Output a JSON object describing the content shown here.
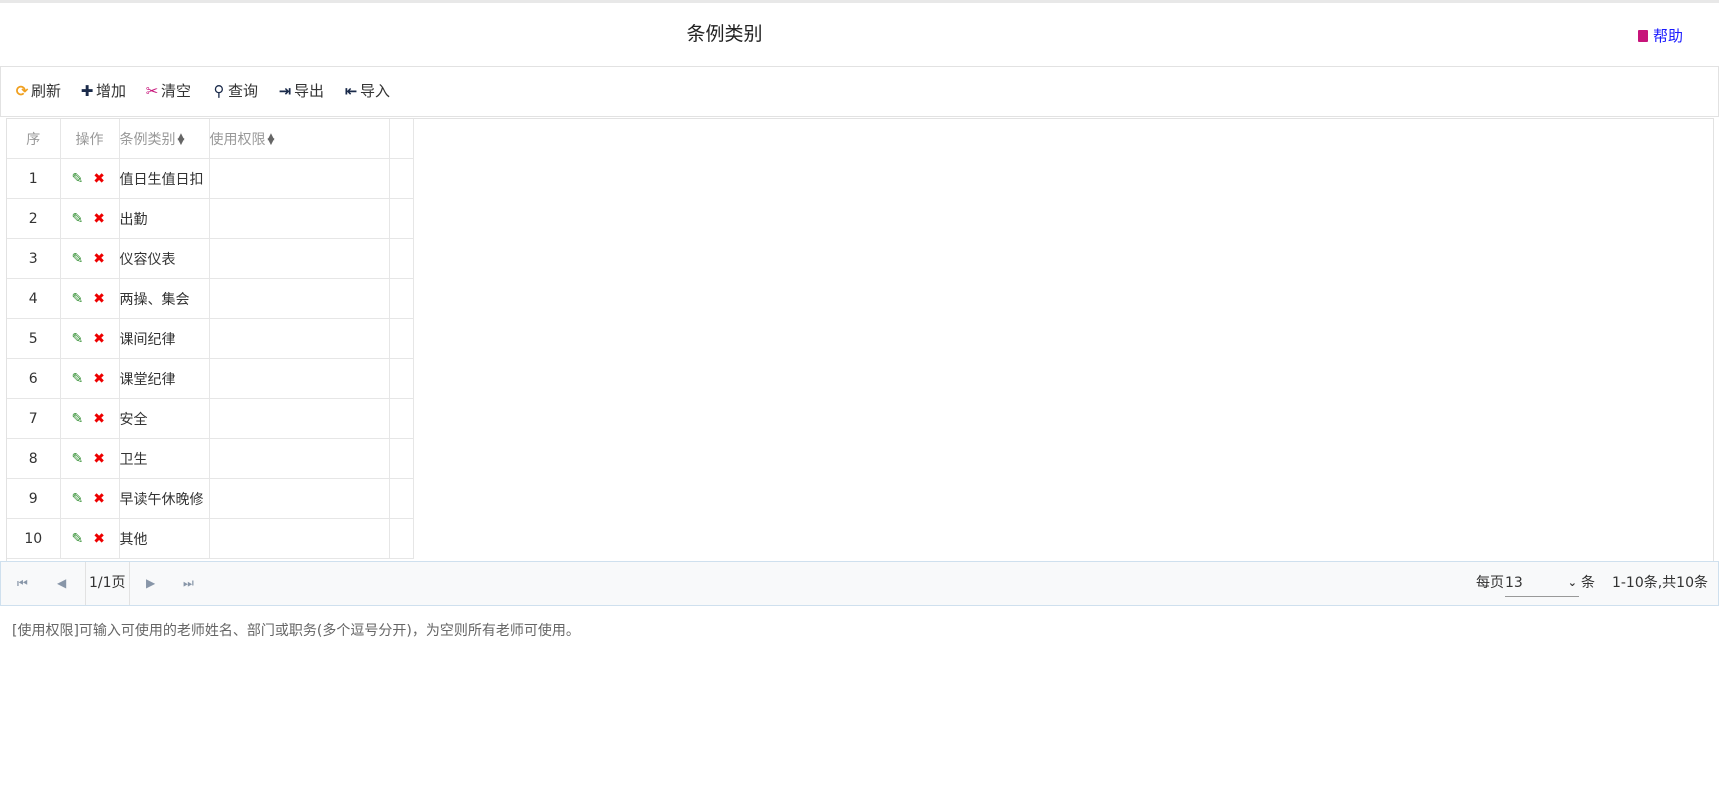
{
  "header": {
    "title": "条例类别",
    "help_label": "帮助"
  },
  "toolbar": {
    "refresh": "刷新",
    "add": "增加",
    "clear": "清空",
    "query": "查询",
    "export": "导出",
    "import": "导入"
  },
  "table": {
    "columns": {
      "seq": "序",
      "ops": "操作",
      "category": "条例类别",
      "permission": "使用权限"
    },
    "rows": [
      {
        "seq": "1",
        "category": "值日生值日扣",
        "permission": ""
      },
      {
        "seq": "2",
        "category": "出勤",
        "permission": ""
      },
      {
        "seq": "3",
        "category": "仪容仪表",
        "permission": ""
      },
      {
        "seq": "4",
        "category": "两操、集会",
        "permission": ""
      },
      {
        "seq": "5",
        "category": "课间纪律",
        "permission": ""
      },
      {
        "seq": "6",
        "category": "课堂纪律",
        "permission": ""
      },
      {
        "seq": "7",
        "category": "安全",
        "permission": ""
      },
      {
        "seq": "8",
        "category": "卫生",
        "permission": ""
      },
      {
        "seq": "9",
        "category": "早读午休晚修",
        "permission": ""
      },
      {
        "seq": "10",
        "category": "其他",
        "permission": ""
      }
    ]
  },
  "pager": {
    "page_info": "1/1页",
    "per_page_label": "每页",
    "per_page_value": "13",
    "per_page_unit": "条",
    "total": "1-10条,共10条"
  },
  "note": "[使用权限]可输入可使用的老师姓名、部门或职务(多个逗号分开)，为空则所有老师可使用。",
  "colors": {
    "refresh": "#f0a020",
    "clear": "#c7147a",
    "edit": "#2a8a2a",
    "delete": "#e00000",
    "help": "#1a1aff"
  }
}
